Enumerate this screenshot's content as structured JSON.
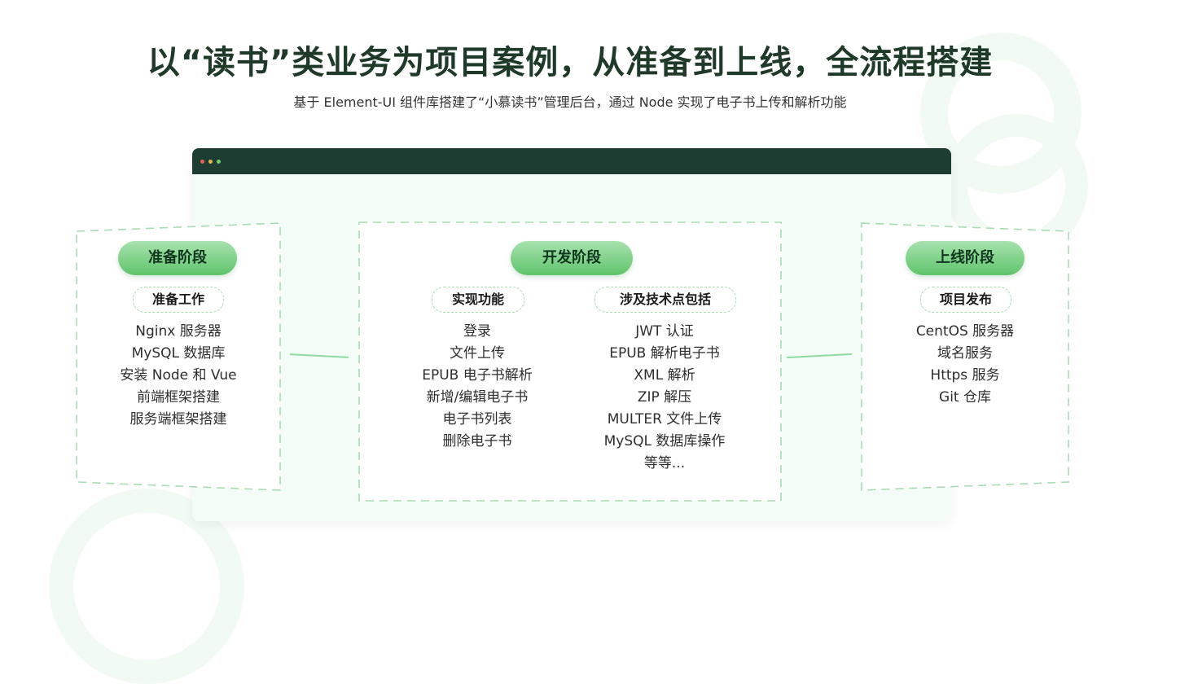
{
  "headline": "以“读书”类业务为项目案例，从准备到上线，全流程搭建",
  "subtitle": "基于 Element-UI 组件库搭建了“小慕读书”管理后台，通过 Node 实现了电子书上传和解析功能",
  "window": {
    "dot_colors": [
      "#e0655a",
      "#e5b54a",
      "#6fcf6a"
    ]
  },
  "stages": {
    "prepare": {
      "title": "准备阶段",
      "section": "准备工作",
      "items": [
        "Nginx 服务器",
        "MySQL 数据库",
        "安装 Node 和 Vue",
        "前端框架搭建",
        "服务端框架搭建"
      ]
    },
    "develop": {
      "title": "开发阶段",
      "features_title": "实现功能",
      "features": [
        "登录",
        "文件上传",
        "EPUB 电子书解析",
        "新增/编辑电子书",
        "电子书列表",
        "删除电子书"
      ],
      "tech_title": "涉及技术点包括",
      "tech": [
        "JWT 认证",
        "EPUB 解析电子书",
        "XML 解析",
        "ZIP 解压",
        "MULTER 文件上传",
        "MySQL 数据库操作",
        "等等..."
      ]
    },
    "launch": {
      "title": "上线阶段",
      "section": "项目发布",
      "items": [
        "CentOS 服务器",
        "域名服务",
        "Https 服务",
        "Git 仓库"
      ]
    }
  },
  "colors": {
    "heading": "#1f3a28",
    "titlebar": "#1d3d32",
    "pill_gradient_top": "#a8e2ae",
    "pill_gradient_bottom": "#5fc46b",
    "dashed_border": "#a8dcb4"
  }
}
